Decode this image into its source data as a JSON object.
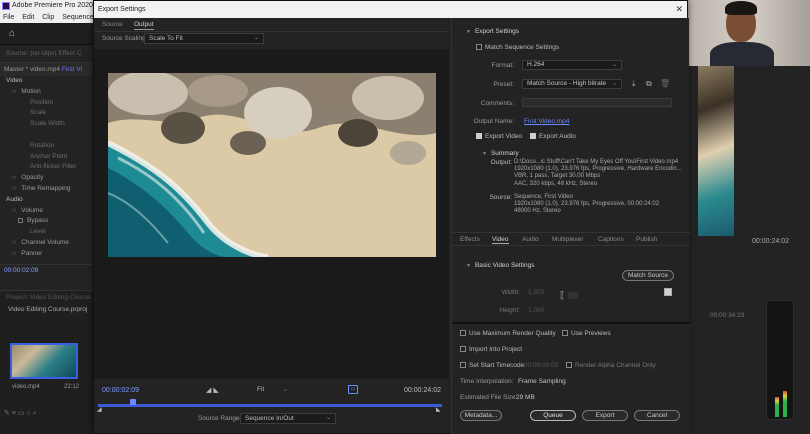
{
  "app": {
    "title": "Adobe Premiere Pro 2020 - D",
    "menu": [
      "File",
      "Edit",
      "Clip",
      "Sequence",
      "Ma"
    ]
  },
  "left_panel": {
    "tabs_text": "Source: (no clips)    Effect C",
    "master_label": "Master * video.mp4",
    "sequence_label": "First Vi",
    "rows": [
      {
        "kind": "section",
        "label": "Video"
      },
      {
        "kind": "fx",
        "label": "Motion"
      },
      {
        "kind": "sub",
        "label": "Position"
      },
      {
        "kind": "sub",
        "label": "Scale"
      },
      {
        "kind": "sub",
        "label": "Scale Width"
      },
      {
        "kind": "blank",
        "label": ""
      },
      {
        "kind": "sub",
        "label": "Rotation"
      },
      {
        "kind": "sub",
        "label": "Anchor Point"
      },
      {
        "kind": "sub",
        "label": "Anti-flicker Filter"
      },
      {
        "kind": "fx",
        "label": "Opacity"
      },
      {
        "kind": "fx",
        "label": "Time Remapping"
      },
      {
        "kind": "section",
        "label": "Audio"
      },
      {
        "kind": "fx",
        "label": "Volume"
      },
      {
        "kind": "bypass",
        "label": "Bypass"
      },
      {
        "kind": "sub",
        "label": "Level"
      },
      {
        "kind": "fx",
        "label": "Channel Volume"
      },
      {
        "kind": "fx",
        "label": "Panner"
      }
    ],
    "timecode": "00:00:02:09"
  },
  "project_panel": {
    "title": "Project: Video Editing Course",
    "file": "Video Editing Course.prproj",
    "clip_name": "video.mp4",
    "clip_duration": "22:12"
  },
  "right_bg": {
    "timecode_1": "00:00:24:02",
    "timecode_2": "00:00:34:23"
  },
  "dialog": {
    "title": "Export Settings",
    "source_tabs": [
      "Source",
      "Output"
    ],
    "active_source_tab": "Output",
    "source_scaling_label": "Source Scaling:",
    "source_scaling_value": "Scale To Fit",
    "timecode_current": "00:00:02:09",
    "timecode_duration": "00:00:24:02",
    "fit_value": "Fit",
    "source_range_label": "Source Range:",
    "source_range_value": "Sequence In/Out"
  },
  "export_settings": {
    "section_title": "Export Settings",
    "match_sequence_label": "Match Sequence Settings",
    "format_label": "Format:",
    "format_value": "H.264",
    "preset_label": "Preset:",
    "preset_value": "Match Source - High bitrate",
    "comments_label": "Comments:",
    "output_name_label": "Output Name:",
    "output_name_value": "First Video.mp4",
    "export_video_label": "Export Video",
    "export_audio_label": "Export Audio",
    "summary_title": "Summary",
    "output_label": "Output:",
    "output_lines": [
      "D:\\Docu...ic Stuff\\Can't Take My Eyes Off You\\First Video.mp4",
      "1920x1080 (1.0), 23.976 fps, Progressive, Hardware Encodin...",
      "VBR, 1 pass, Target 30.00 Mbps",
      "AAC, 320 kbps, 48 kHz, Stereo"
    ],
    "source_label": "Source:",
    "source_lines": [
      "Sequence, First Video",
      "1920x1080 (1.0), 23.976 fps, Progressive, 00:00:24:02",
      "48000 Hz, Stereo"
    ]
  },
  "settings_tabs": [
    "Effects",
    "Video",
    "Audio",
    "Multiplexer",
    "Captions",
    "Publish"
  ],
  "active_settings_tab": "Video",
  "video_settings": {
    "title": "Basic Video Settings",
    "match_source_button": "Match Source",
    "width_label": "Width:",
    "width_value": "1,920",
    "height_label": "Height:",
    "height_value": "1,080"
  },
  "bottom": {
    "max_render_quality": "Use Maximum Render Quality",
    "use_previews": "Use Previews",
    "import_into_project": "Import Into Project",
    "set_start_timecode": "Set Start Timecode",
    "start_timecode_value": "00:00:00:00",
    "render_alpha": "Render Alpha Channel Only",
    "time_interpolation_label": "Time Interpolation:",
    "time_interpolation_value": "Frame Sampling",
    "file_size_label": "Estimated File Size:",
    "file_size_value": "29 MB",
    "metadata_button": "Metadata...",
    "queue_button": "Queue",
    "export_button": "Export",
    "cancel_button": "Cancel"
  },
  "colors": {
    "accent_blue": "#6b8aff",
    "dialog_bg": "#232323",
    "titlebar_bg": "#f2f2f2"
  }
}
